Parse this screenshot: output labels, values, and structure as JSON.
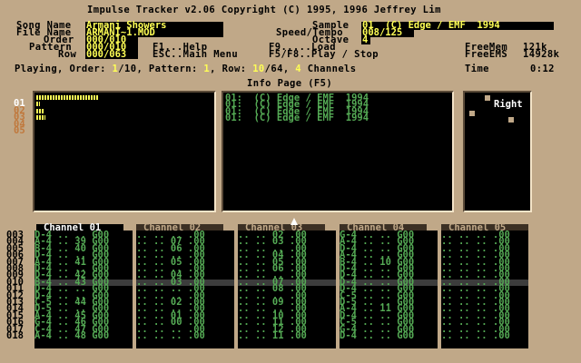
{
  "title": "Impulse Tracker v2.06 Copyright (C) 1995, 1996 Jeffrey Lim",
  "fields": {
    "song_name_label": "Song Name",
    "song_name": "Armani Showers",
    "file_name_label": "File Name",
    "file_name": "ARMANI~1.MOD",
    "order_label": "Order",
    "order": "000/010",
    "pattern_label": "Pattern",
    "pattern": "000/010",
    "row_label": "Row",
    "row": "000/063",
    "sample_label": "Sample",
    "sample": "01  (C) Edge / EMF  1994",
    "speed_label": "Speed/Tempo",
    "speed": "008/125",
    "octave_label": "Octave",
    "octave": "4"
  },
  "help": {
    "f1": "F1...Help",
    "esc": "ESC..Main Menu",
    "f9": "F9.....Load",
    "f5": "F5/F8..Play / Stop"
  },
  "memory": {
    "freemem_label": "FreeMem",
    "freemem": "121k",
    "freeems_label": "FreeEMS",
    "freeems": "14928k",
    "time_label": "Time",
    "time": "0:12"
  },
  "status": {
    "playing_prefix": "Playing, Order: ",
    "order_cur": "1",
    "order_total": "/10",
    "pattern_text": ", Pattern: ",
    "pattern_cur": "1",
    "row_text": ", Row: ",
    "row_cur": "10",
    "row_total": "/64",
    "channels_text": ", ",
    "channels_cur": "4",
    "channels_suffix": " Channels"
  },
  "info_page_title": "Info Page (F5)",
  "channel_numbers": [
    "01",
    "02",
    "03",
    "04",
    "05"
  ],
  "volume_levels": [
    0.95,
    0.05,
    0.12,
    0.14
  ],
  "sample_list": [
    "01:  (C) Edge / EMF  1994",
    "01:  (C) Edge / EMF  1994",
    "01:  (C) Edge / EMF  1994",
    "01:  (C) Edge / EMF  1994"
  ],
  "panning_label": "Right",
  "channel_headers": [
    "Channel 01",
    "Channel 02",
    "Channel 03",
    "Channel 04",
    "Channel 05"
  ],
  "row_numbers": [
    "003",
    "004",
    "005",
    "006",
    "007",
    "008",
    "009",
    "010",
    "011",
    "012",
    "013",
    "014",
    "015",
    "016",
    "017",
    "018"
  ],
  "pattern": {
    "ch1": [
      "D-4 .. .. G00",
      "A-4 .. 39 G00",
      "B-4 .. 40 G00",
      "D-4 .. .. G00",
      "A-4 .. 41 G00",
      "D-4 .. .. G00",
      "D-4 .. 42 G00",
      "B-4 .. 43 G00",
      "D-4 .. .. G00",
      "D-4 .. .. G00",
      "C-5 .. 44 G00",
      "D-5 .. .. G00",
      "A-4 .. 45 G00",
      "G-4 .. 46 G00",
      "C-4 .. 47 G00",
      "A-4 .. 48 G00"
    ],
    "ch2": [
      ".. .. .. .00",
      ".. .. 07 .00",
      ".. .. 06 .00",
      ".. .. .. .00",
      ".. .. 05 .00",
      ".. .. .. .00",
      ".. .. 04 .00",
      ".. .. 03 .00",
      ".. .. .. .00",
      ".. .. .. .00",
      ".. .. 02 .00",
      ".. .. .. .00",
      ".. .. 01 .00",
      ".. .. 00 .00",
      ".. .. .. .00",
      ".. .. .. .00"
    ],
    "ch3": [
      ".. .. 02 .00",
      ".. .. 03 .00",
      ".. .. .. .00",
      ".. .. 04 .00",
      ".. .. 05 .00",
      ".. .. 06 .00",
      ".. .. .. .00",
      ".. .. 07 .00",
      ".. .. 08 .00",
      ".. .. .. .00",
      ".. .. 09 .00",
      ".. .. .. .00",
      ".. .. 10 .00",
      ".. .. 11 .00",
      ".. .. 12 .00",
      ".. .. 11 .00"
    ],
    "ch4": [
      "G-4 .. .. G00",
      "A-4 .. .. G00",
      "D-4 .. .. G00",
      "A-4 .. .. G00",
      "B-4 .. 10 G00",
      "D-4 .. .. G00",
      "D-4 .. .. G00",
      "D-4 .. .. G00",
      "D-4 .. .. G00",
      "C-5 .. .. G00",
      "D-5 .. .. G00",
      "A-4 .. 11 G00",
      "D-4 .. .. G00",
      "C-5 .. .. G00",
      "G-4 .. .. G00",
      "D-4 .. .. G00"
    ],
    "ch5": [
      ".. .. .. .00",
      ".. .. .. .00",
      ".. .. .. .00",
      ".. .. .. .00",
      ".. .. .. .00",
      ".. .. .. .00",
      ".. .. .. .00",
      ".. .. .. .00",
      ".. .. .. .00",
      ".. .. .. .00",
      ".. .. .. .00",
      ".. .. .. .00",
      ".. .. .. .00",
      ".. .. .. .00",
      ".. .. .. .00",
      ".. .. .. .00"
    ]
  },
  "colors": {
    "background": "#c0a888",
    "field_text": "#ffff55",
    "note_text": "#55aa55",
    "highlight": "#ffff55"
  }
}
